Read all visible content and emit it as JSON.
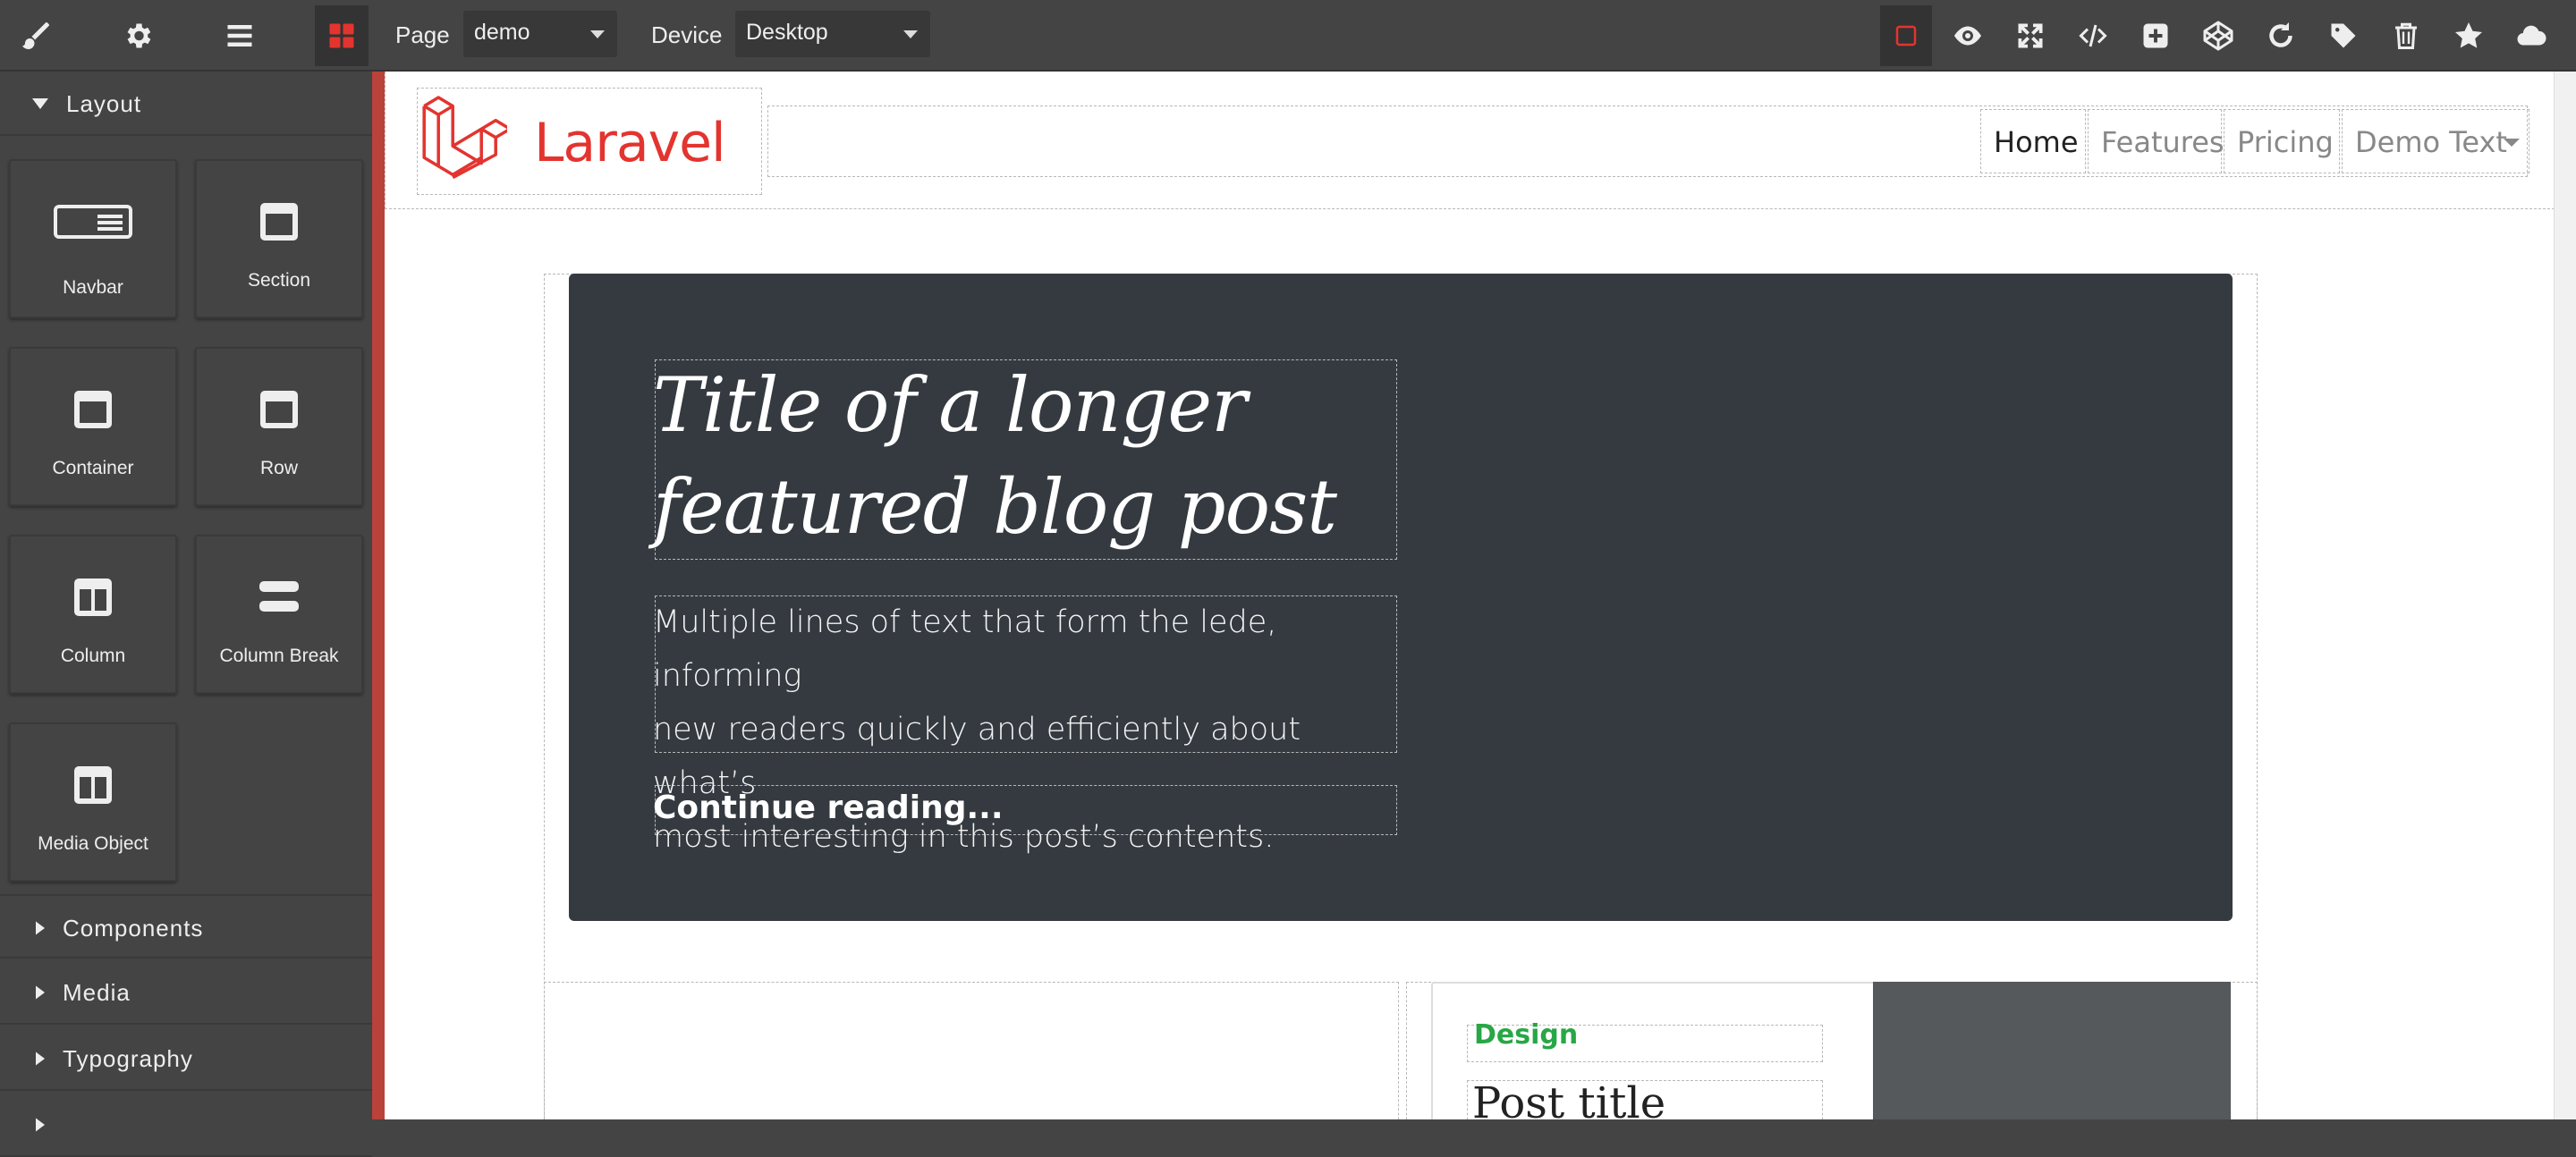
{
  "topbar": {
    "page_label": "Page",
    "page_value": "demo",
    "device_label": "Device",
    "device_value": "Desktop",
    "left_icons": [
      "paint-brush-icon",
      "gear-icon",
      "hamburger-menu-icon",
      "blocks-grid-icon"
    ],
    "right_icons": [
      "outline-square-icon",
      "eye-icon",
      "fullscreen-icon",
      "code-icon",
      "plus-square-icon",
      "codepen-icon",
      "undo-icon",
      "tag-icon",
      "trash-icon",
      "star-icon",
      "cloud-icon"
    ]
  },
  "sidebar": {
    "open_category": "Layout",
    "blocks": [
      {
        "label": "Navbar",
        "icon": "navbar-block-icon"
      },
      {
        "label": "Section",
        "icon": "section-block-icon"
      },
      {
        "label": "Container",
        "icon": "container-block-icon"
      },
      {
        "label": "Row",
        "icon": "row-block-icon"
      },
      {
        "label": "Column",
        "icon": "column-block-icon"
      },
      {
        "label": "Column Break",
        "icon": "column-break-block-icon"
      },
      {
        "label": "Media Object",
        "icon": "media-object-block-icon"
      }
    ],
    "categories": [
      "Components",
      "Media",
      "Typography"
    ]
  },
  "site": {
    "brand": "Laravel",
    "nav": [
      {
        "label": "Home",
        "active": true
      },
      {
        "label": "Features",
        "active": false
      },
      {
        "label": "Pricing",
        "active": false
      },
      {
        "label": "Demo Text",
        "active": false,
        "dropdown": true
      }
    ],
    "hero": {
      "title_line1": "Title of a longer",
      "title_line2": "featured blog post",
      "lede_line1": "Multiple lines of text that form the lede, informing",
      "lede_line2": "new readers quickly and efficiently about what’s",
      "lede_line3": "most interesting in this post’s contents.",
      "link": "Continue reading..."
    },
    "card": {
      "badge": "Design",
      "title": "Post title"
    }
  },
  "colors": {
    "accent": "#e3342f",
    "panel": "#444444",
    "hero_bg": "#343a40",
    "badge": "#28a745"
  }
}
